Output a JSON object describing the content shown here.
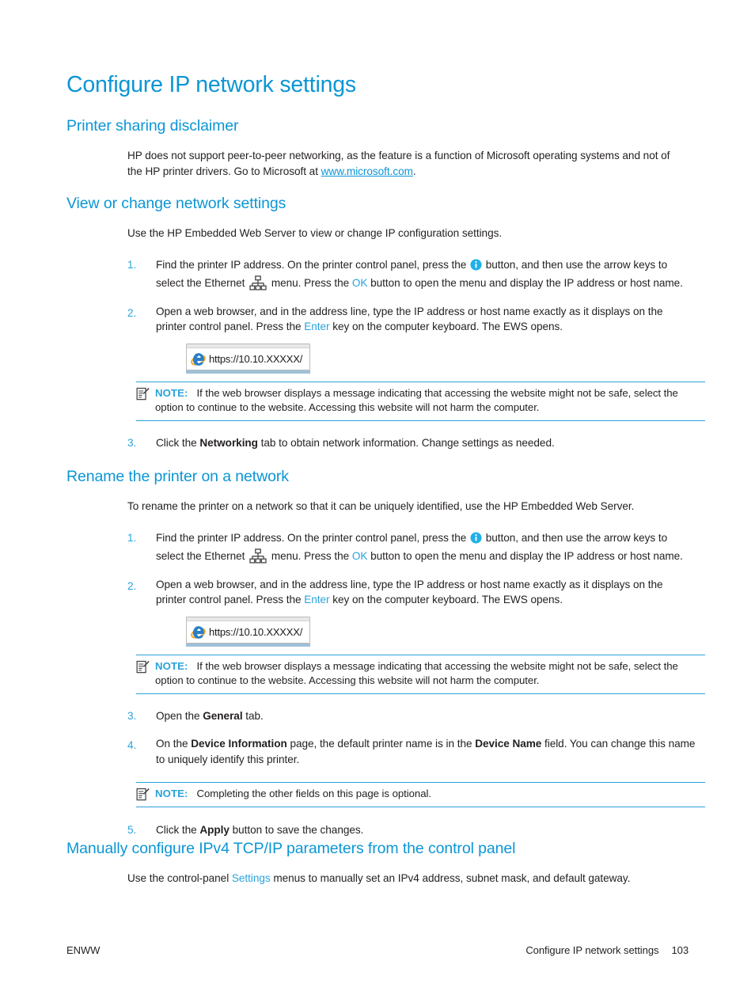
{
  "page": {
    "title": "Configure IP network settings",
    "footer": {
      "left": "ENWW",
      "right_title": "Configure IP network settings",
      "page_number": "103"
    }
  },
  "sections": {
    "printer_sharing": {
      "heading": "Printer sharing disclaimer",
      "body_pre": "HP does not support peer-to-peer networking, as the feature is a function of Microsoft operating systems and not of the HP printer drivers. Go to Microsoft at ",
      "link": "www.microsoft.com",
      "body_post": "."
    },
    "view_or_change": {
      "heading": "View or change network settings",
      "intro": "Use the HP Embedded Web Server to view or change IP configuration settings.",
      "steps": [
        {
          "number": "1.",
          "part1": "Find the printer IP address. On the printer control panel, press the ",
          "icon1": "info-icon",
          "part2": " button, and then use the arrow keys to select the Ethernet ",
          "icon2": "ethernet-icon",
          "part3": " menu. Press the ",
          "ui_key": "OK",
          "part4": " button to open the menu and display the IP address or host name."
        },
        {
          "number": "2.",
          "part1": "Open a web browser, and in the address line, type the IP address or host name exactly as it displays on the printer control panel. Press the ",
          "ui_key": "Enter",
          "part2": " key on the computer keyboard. The EWS opens."
        },
        {
          "number": "3.",
          "part1": "Click the ",
          "bold1": "Networking",
          "part2": " tab to obtain network information. Change settings as needed."
        }
      ],
      "address_bar": {
        "icon": "internet-explorer-icon",
        "url": "https://10.10.XXXXX/"
      },
      "note": {
        "label": "NOTE:",
        "text": "If the web browser displays a message indicating that accessing the website might not be safe, select the option to continue to the website. Accessing this website will not harm the computer."
      }
    },
    "rename_printer": {
      "heading": "Rename the printer on a network",
      "intro": "To rename the printer on a network so that it can be uniquely identified, use the HP Embedded Web Server.",
      "steps": [
        {
          "number": "1.",
          "part1": "Find the printer IP address. On the printer control panel, press the ",
          "icon1": "info-icon",
          "part2": " button, and then use the arrow keys to select the Ethernet ",
          "icon2": "ethernet-icon",
          "part3": " menu. Press the ",
          "ui_key": "OK",
          "part4": " button to open the menu and display the IP address or host name."
        },
        {
          "number": "2.",
          "part1": "Open a web browser, and in the address line, type the IP address or host name exactly as it displays on the printer control panel. Press the ",
          "ui_key": "Enter",
          "part2": " key on the computer keyboard. The EWS opens."
        },
        {
          "number": "3.",
          "part1": "Open the ",
          "bold1": "General",
          "part2": " tab."
        },
        {
          "number": "4.",
          "part1": "On the ",
          "bold1": "Device Information",
          "part2": " page, the default printer name is in the ",
          "bold2": "Device Name",
          "part3": " field. You can change this name to uniquely identify this printer."
        },
        {
          "number": "5.",
          "part1": "Click the ",
          "bold1": "Apply",
          "part2": " button to save the changes."
        }
      ],
      "address_bar": {
        "icon": "internet-explorer-icon",
        "url": "https://10.10.XXXXX/"
      },
      "note_browser": {
        "label": "NOTE:",
        "text": "If the web browser displays a message indicating that accessing the website might not be safe, select the option to continue to the website. Accessing this website will not harm the computer."
      },
      "note_optional": {
        "label": "NOTE:",
        "text": "Completing the other fields on this page is optional."
      }
    },
    "manual_ipv4": {
      "heading": "Manually configure IPv4 TCP/IP parameters from the control panel",
      "body_pre": "Use the control-panel ",
      "ui_key": "Settings",
      "body_post": " menus to manually set an IPv4 address, subnet mask, and default gateway."
    }
  },
  "colors": {
    "heading_blue": "#0b96d5",
    "ui_blue": "#29a3dc",
    "body_black": "#231f20"
  }
}
